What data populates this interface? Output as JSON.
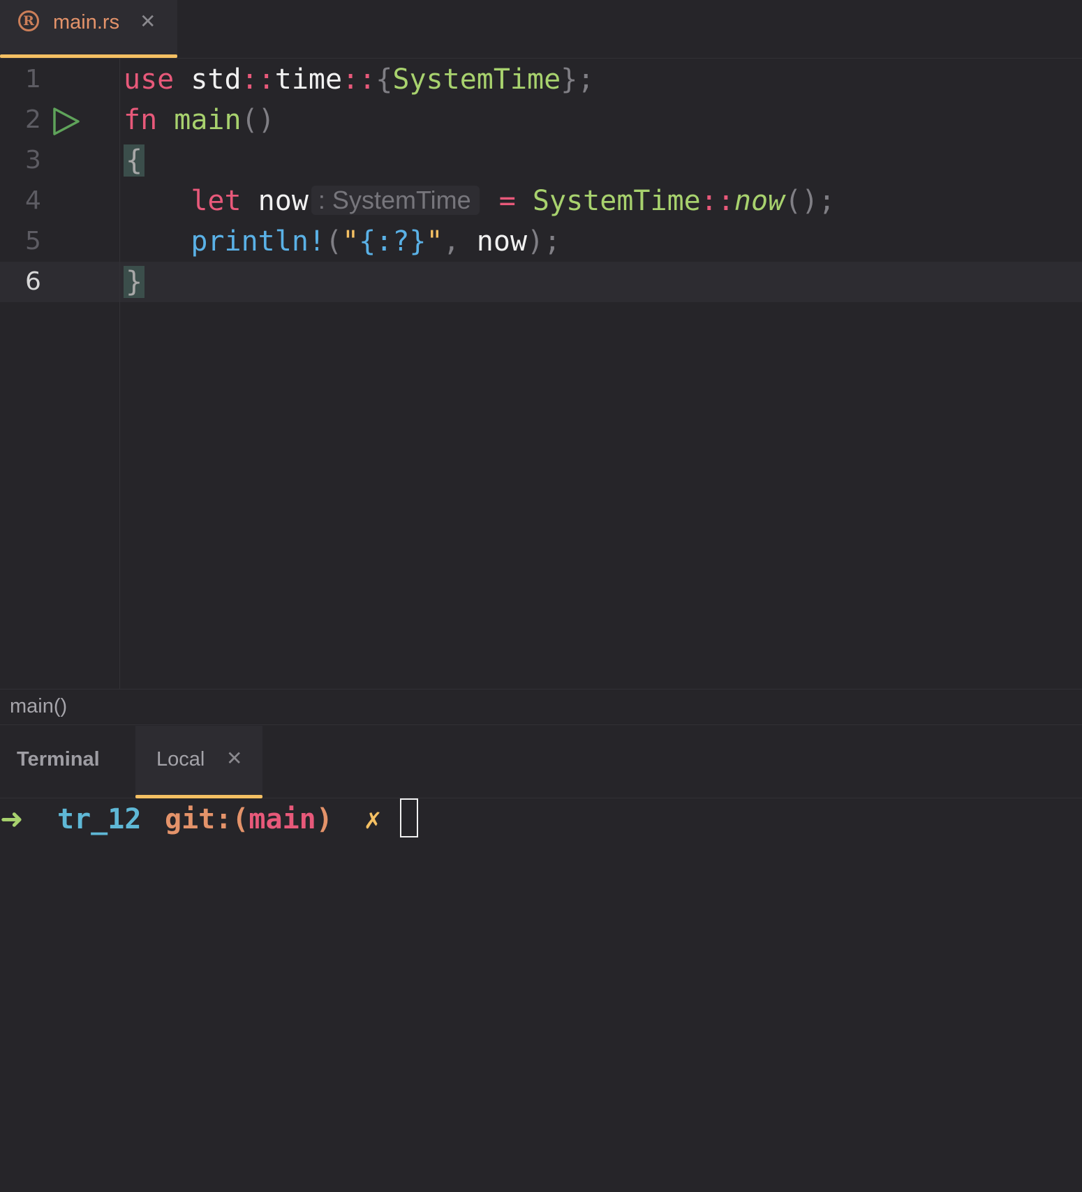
{
  "editor_tab": {
    "filename": "main.rs",
    "close": "✕"
  },
  "code": {
    "line_numbers": [
      "1",
      "2",
      "3",
      "4",
      "5",
      "6"
    ],
    "l1": {
      "kw": "use",
      "std": "std",
      "sep1": "::",
      "time": "time",
      "sep2": "::",
      "lb": "{",
      "type": "SystemTime",
      "rb": "}",
      "semi": ";"
    },
    "l2": {
      "kw": "fn",
      "name": "main",
      "parens": "()"
    },
    "l3": {
      "brace": "{"
    },
    "l4": {
      "kw": "let",
      "var": "now",
      "hint": ": SystemTime",
      "eq": "=",
      "type": "SystemTime",
      "sep": "::",
      "call": "now",
      "parens": "()",
      "semi": ";"
    },
    "l5": {
      "macro": "println!",
      "lp": "(",
      "q1": "\"",
      "fmt": "{:?}",
      "q2": "\"",
      "comma": ",",
      "arg": "now",
      "rp": ")",
      "semi": ";"
    },
    "l6": {
      "brace": "}"
    }
  },
  "breadcrumb": {
    "text": "main()"
  },
  "terminal": {
    "title": "Terminal",
    "tab_label": "Local",
    "tab_close": "✕",
    "prompt_arrow": "➜",
    "dir": "tr_12",
    "git_prefix": "git:(",
    "branch": "main",
    "git_suffix": ")",
    "dirty_marker": "✗"
  },
  "colors": {
    "accent": "#f4c063",
    "keyword": "#e8597a",
    "type": "#a8d26e",
    "macro": "#5ab1e6"
  }
}
